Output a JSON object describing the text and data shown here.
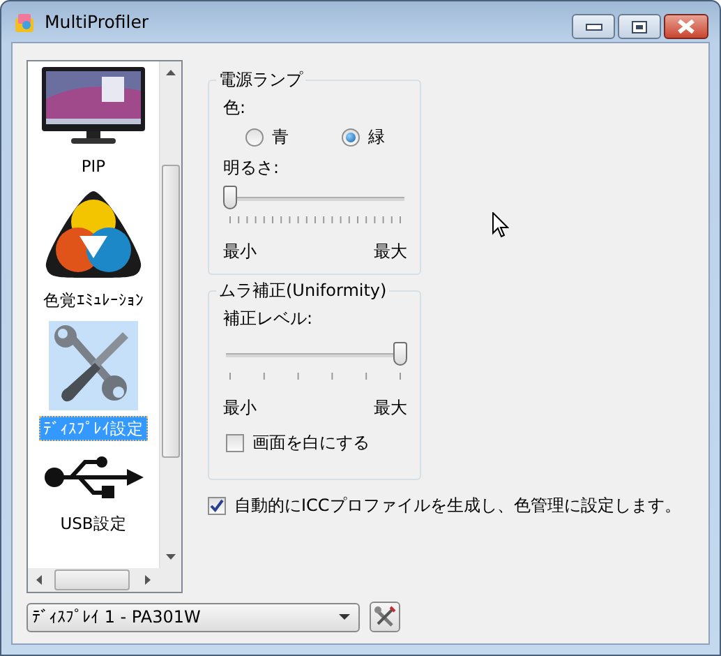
{
  "window": {
    "title": "MultiProfiler"
  },
  "sidebar": {
    "items": [
      {
        "label": "PIP",
        "kind": "monitor",
        "selected": false
      },
      {
        "label": "色覚ｴﾐｭﾚｰｼｮﾝ",
        "kind": "color-triangle",
        "selected": false
      },
      {
        "label": "ﾃﾞｨｽﾌﾟﾚｲ設定",
        "kind": "tools",
        "selected": true
      },
      {
        "label": "USB設定",
        "kind": "usb",
        "selected": false
      }
    ]
  },
  "power_lamp": {
    "title": "電源ランプ",
    "color_label": "色:",
    "colors": [
      {
        "label": "青",
        "selected": false
      },
      {
        "label": "緑",
        "selected": true
      }
    ],
    "brightness_label": "明るさ:",
    "brightness": {
      "level": 0
    },
    "min_label": "最小",
    "max_label": "最大"
  },
  "uniformity": {
    "title": "ムラ補正(Uniformity)",
    "level_label": "補正レベル:",
    "correction": {
      "level": 1
    },
    "min_label": "最小",
    "max_label": "最大",
    "white_screen": {
      "label": "画面を白にする",
      "checked": false
    }
  },
  "auto_icc": {
    "label": "自動的にICCプロファイルを生成し、色管理に設定します。",
    "checked": true
  },
  "display_select": {
    "value": "ﾃﾞｨｽﾌﾟﾚｲ 1 - PA301W"
  }
}
